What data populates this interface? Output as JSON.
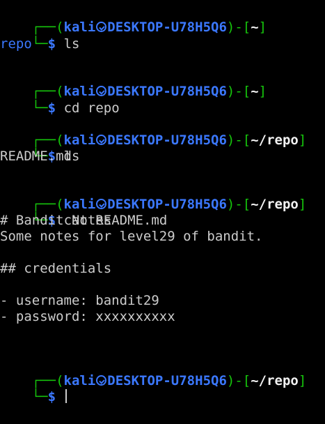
{
  "colors": {
    "background": "#000000",
    "frame": "#16c60c",
    "user_host": "#3b78ff",
    "path": "#f2f2f2",
    "output": "#cccccc"
  },
  "prompt": {
    "box_open": "┌──(",
    "user": "kali",
    "separator_icon": "kali-skull-icon",
    "host": "DESKTOP-U78H5Q6",
    "bracket_sep": ")-[",
    "bracket_close": "]",
    "second_line": "└─",
    "dollar": "$"
  },
  "blocks": [
    {
      "path": "~",
      "command": "ls",
      "output": [
        "repo"
      ],
      "output_is_dir": true
    },
    {
      "path": "~",
      "command": "cd repo",
      "output": []
    },
    {
      "path": "~/repo",
      "command": "ls",
      "output": [
        "README.md"
      ]
    },
    {
      "path": "~/repo",
      "command": "cat README.md",
      "output": [
        "# Bandit Notes",
        "Some notes for level29 of bandit.",
        "",
        "## credentials",
        "",
        "- username: bandit29",
        "- password: xxxxxxxxxx"
      ]
    },
    {
      "path": "~/repo",
      "command": "",
      "output": [],
      "active": true
    }
  ]
}
